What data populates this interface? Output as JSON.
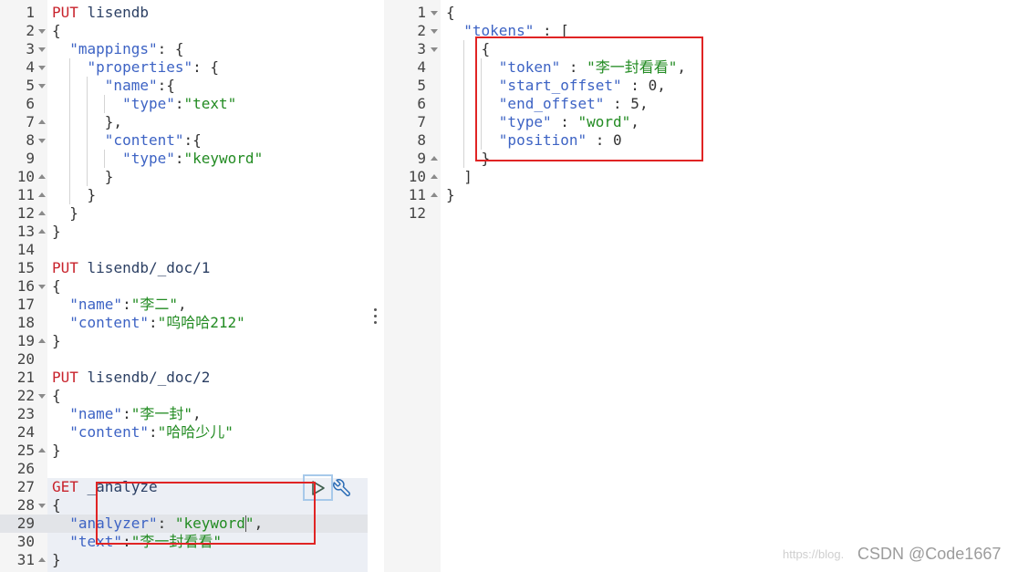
{
  "colors": {
    "method": "#c8232c",
    "url": "#2b3f63",
    "key": "#3d63c4",
    "string": "#228b22",
    "number": "#333333",
    "punct": "#333333",
    "gutter_text": "#444444",
    "annotation": "#e02424",
    "run_button_focus": "#a7c9ea",
    "settings_icon": "#2a6cb5"
  },
  "icons": {
    "run": "play-icon",
    "settings": "wrench-icon",
    "resizer": "vertical-ellipsis-icon"
  },
  "request_editor": {
    "active_line": 29,
    "selected_request": {
      "first_line": 27,
      "last_line": 31
    },
    "cursor": {
      "line": 29,
      "column": 22
    },
    "lines": [
      {
        "n": 1,
        "fold": "",
        "tokens": [
          {
            "method": "PUT"
          },
          {
            "url": " lisendb"
          }
        ]
      },
      {
        "n": 2,
        "fold": "fold-arrow-down-icon",
        "tokens": [
          {
            "punct": "{"
          }
        ]
      },
      {
        "n": 3,
        "fold": "fold-arrow-down-icon",
        "tokens": [
          {
            "key": "  \"mappings\""
          },
          {
            "punct": ": {"
          }
        ]
      },
      {
        "n": 4,
        "fold": "fold-arrow-down-icon",
        "tokens": [
          {
            "key": "    \"properties\""
          },
          {
            "punct": ": {"
          }
        ]
      },
      {
        "n": 5,
        "fold": "fold-arrow-down-icon",
        "tokens": [
          {
            "key": "      \"name\""
          },
          {
            "punct": ":{"
          }
        ]
      },
      {
        "n": 6,
        "fold": "",
        "tokens": [
          {
            "key": "        \"type\""
          },
          {
            "punct": ":"
          },
          {
            "string": "\"text\""
          }
        ]
      },
      {
        "n": 7,
        "fold": "fold-arrow-up-icon",
        "tokens": [
          {
            "punct": "      },"
          }
        ]
      },
      {
        "n": 8,
        "fold": "fold-arrow-down-icon",
        "tokens": [
          {
            "key": "      \"content\""
          },
          {
            "punct": ":{"
          }
        ]
      },
      {
        "n": 9,
        "fold": "",
        "tokens": [
          {
            "key": "        \"type\""
          },
          {
            "punct": ":"
          },
          {
            "string": "\"keyword\""
          }
        ]
      },
      {
        "n": 10,
        "fold": "fold-arrow-up-icon",
        "tokens": [
          {
            "punct": "      }"
          }
        ]
      },
      {
        "n": 11,
        "fold": "fold-arrow-up-icon",
        "tokens": [
          {
            "punct": "    }"
          }
        ]
      },
      {
        "n": 12,
        "fold": "fold-arrow-up-icon",
        "tokens": [
          {
            "punct": "  }"
          }
        ]
      },
      {
        "n": 13,
        "fold": "fold-arrow-up-icon",
        "tokens": [
          {
            "punct": "}"
          }
        ]
      },
      {
        "n": 14,
        "fold": "",
        "tokens": []
      },
      {
        "n": 15,
        "fold": "",
        "tokens": [
          {
            "method": "PUT"
          },
          {
            "url": " lisendb/_doc/1"
          }
        ]
      },
      {
        "n": 16,
        "fold": "fold-arrow-down-icon",
        "tokens": [
          {
            "punct": "{"
          }
        ]
      },
      {
        "n": 17,
        "fold": "",
        "tokens": [
          {
            "key": "  \"name\""
          },
          {
            "punct": ":"
          },
          {
            "string": "\"李二\""
          },
          {
            "punct": ","
          }
        ]
      },
      {
        "n": 18,
        "fold": "",
        "tokens": [
          {
            "key": "  \"content\""
          },
          {
            "punct": ":"
          },
          {
            "string": "\"呜哈哈212\""
          }
        ]
      },
      {
        "n": 19,
        "fold": "fold-arrow-up-icon",
        "tokens": [
          {
            "punct": "}"
          }
        ]
      },
      {
        "n": 20,
        "fold": "",
        "tokens": []
      },
      {
        "n": 21,
        "fold": "",
        "tokens": [
          {
            "method": "PUT"
          },
          {
            "url": " lisendb/_doc/2"
          }
        ]
      },
      {
        "n": 22,
        "fold": "fold-arrow-down-icon",
        "tokens": [
          {
            "punct": "{"
          }
        ]
      },
      {
        "n": 23,
        "fold": "",
        "tokens": [
          {
            "key": "  \"name\""
          },
          {
            "punct": ":"
          },
          {
            "string": "\"李一封\""
          },
          {
            "punct": ","
          }
        ]
      },
      {
        "n": 24,
        "fold": "",
        "tokens": [
          {
            "key": "  \"content\""
          },
          {
            "punct": ":"
          },
          {
            "string": "\"哈哈少儿\""
          }
        ]
      },
      {
        "n": 25,
        "fold": "fold-arrow-up-icon",
        "tokens": [
          {
            "punct": "}"
          }
        ]
      },
      {
        "n": 26,
        "fold": "",
        "tokens": []
      },
      {
        "n": 27,
        "fold": "",
        "tokens": [
          {
            "method": "GET"
          },
          {
            "url": " _analyze"
          }
        ]
      },
      {
        "n": 28,
        "fold": "fold-arrow-down-icon",
        "tokens": [
          {
            "punct": "{"
          }
        ]
      },
      {
        "n": 29,
        "fold": "",
        "tokens": [
          {
            "key": "  \"analyzer\""
          },
          {
            "punct": ": "
          },
          {
            "string": "\"keyword\""
          },
          {
            "punct": ","
          }
        ]
      },
      {
        "n": 30,
        "fold": "",
        "tokens": [
          {
            "key": "  \"text\""
          },
          {
            "punct": ":"
          },
          {
            "string": "\"李一封看看\""
          }
        ]
      },
      {
        "n": 31,
        "fold": "fold-arrow-up-icon",
        "tokens": [
          {
            "punct": "}"
          }
        ]
      }
    ]
  },
  "response_viewer": {
    "lines": [
      {
        "n": 1,
        "fold": "fold-arrow-down-icon",
        "tokens": [
          {
            "punct": "{"
          }
        ]
      },
      {
        "n": 2,
        "fold": "fold-arrow-down-icon",
        "tokens": [
          {
            "key": "  \"tokens\""
          },
          {
            "punct": " : ["
          }
        ]
      },
      {
        "n": 3,
        "fold": "fold-arrow-down-icon",
        "tokens": [
          {
            "punct": "    {"
          }
        ]
      },
      {
        "n": 4,
        "fold": "",
        "tokens": [
          {
            "key": "      \"token\""
          },
          {
            "punct": " : "
          },
          {
            "string": "\"李一封看看\""
          },
          {
            "punct": ","
          }
        ]
      },
      {
        "n": 5,
        "fold": "",
        "tokens": [
          {
            "key": "      \"start_offset\""
          },
          {
            "punct": " : "
          },
          {
            "number": "0"
          },
          {
            "punct": ","
          }
        ]
      },
      {
        "n": 6,
        "fold": "",
        "tokens": [
          {
            "key": "      \"end_offset\""
          },
          {
            "punct": " : "
          },
          {
            "number": "5"
          },
          {
            "punct": ","
          }
        ]
      },
      {
        "n": 7,
        "fold": "",
        "tokens": [
          {
            "key": "      \"type\""
          },
          {
            "punct": " : "
          },
          {
            "string": "\"word\""
          },
          {
            "punct": ","
          }
        ]
      },
      {
        "n": 8,
        "fold": "",
        "tokens": [
          {
            "key": "      \"position\""
          },
          {
            "punct": " : "
          },
          {
            "number": "0"
          }
        ]
      },
      {
        "n": 9,
        "fold": "fold-arrow-up-icon",
        "tokens": [
          {
            "punct": "    }"
          }
        ]
      },
      {
        "n": 10,
        "fold": "fold-arrow-up-icon",
        "tokens": [
          {
            "punct": "  ]"
          }
        ]
      },
      {
        "n": 11,
        "fold": "fold-arrow-up-icon",
        "tokens": [
          {
            "punct": "}"
          }
        ]
      },
      {
        "n": 12,
        "fold": "",
        "tokens": []
      }
    ]
  },
  "watermark": {
    "url": "https://blog.",
    "author": "CSDN @Code1667"
  }
}
